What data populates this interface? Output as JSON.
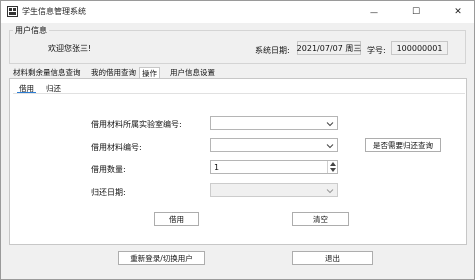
{
  "window": {
    "title": "学生信息管理系统",
    "minimize_glyph": "—",
    "maximize_glyph": "☐",
    "close_glyph": "✕"
  },
  "user_info": {
    "group_title": "用户信息",
    "welcome": "欢迎您张三!",
    "date_label": "系统日期:",
    "date_value": "2021/07/07 周三",
    "student_id_label": "学号:",
    "student_id_value": "100000001"
  },
  "tabs": [
    "材料剩余量信息查询",
    "我的借用查询",
    "操作",
    "用户信息设置"
  ],
  "active_tab": "操作",
  "subtabs": [
    "借用",
    "归还"
  ],
  "active_subtab": "借用",
  "form": {
    "lab_label": "借用材料所属实验室编号:",
    "lab_value": "",
    "material_label": "借用材料编号:",
    "material_value": "",
    "quantity_label": "借用数量:",
    "quantity_value": "1",
    "return_date_label": "归还日期:",
    "return_date_value": "",
    "check_return_button": "是否需要归还查询",
    "borrow_button": "借用",
    "clear_button": "清空"
  },
  "footer": {
    "relogin_button": "重新登录/切换用户",
    "exit_button": "退出"
  },
  "colors": {
    "window_bg": "#f0f0f0",
    "tab_underline": "#2b7cd3"
  }
}
